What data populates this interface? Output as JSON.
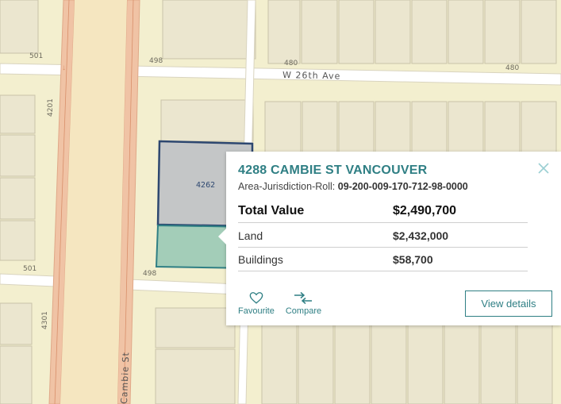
{
  "map": {
    "street_labels": {
      "w26th": "W 26th Ave",
      "cambie": "Cambie St"
    },
    "block_numbers": {
      "n501_top": "501",
      "n498_top": "498",
      "n480_a": "480",
      "n480_b": "480",
      "n4201": "4201",
      "n501_mid": "501",
      "n498_mid": "498",
      "n4301": "4301",
      "parcel": "4262"
    },
    "colors": {
      "map_bg": "#f3efcf",
      "parcel_fill": "#c8cacb",
      "selected_parcel": "#a3cdb8",
      "parcel_outline": "#2d4770",
      "arterial": "#f0c3a5"
    }
  },
  "popup": {
    "title": "4288 CAMBIE ST VANCOUVER",
    "roll_label": "Area-Jurisdiction-Roll:",
    "roll_value": "09-200-009-170-712-98-0000",
    "rows": [
      {
        "label": "Total Value",
        "value": "$2,490,700"
      },
      {
        "label": "Land",
        "value": "$2,432,000"
      },
      {
        "label": "Buildings",
        "value": "$58,700"
      }
    ],
    "actions": {
      "favourite": "Favourite",
      "compare": "Compare"
    },
    "view_details": "View details",
    "accent_color": "#2f7f84"
  }
}
